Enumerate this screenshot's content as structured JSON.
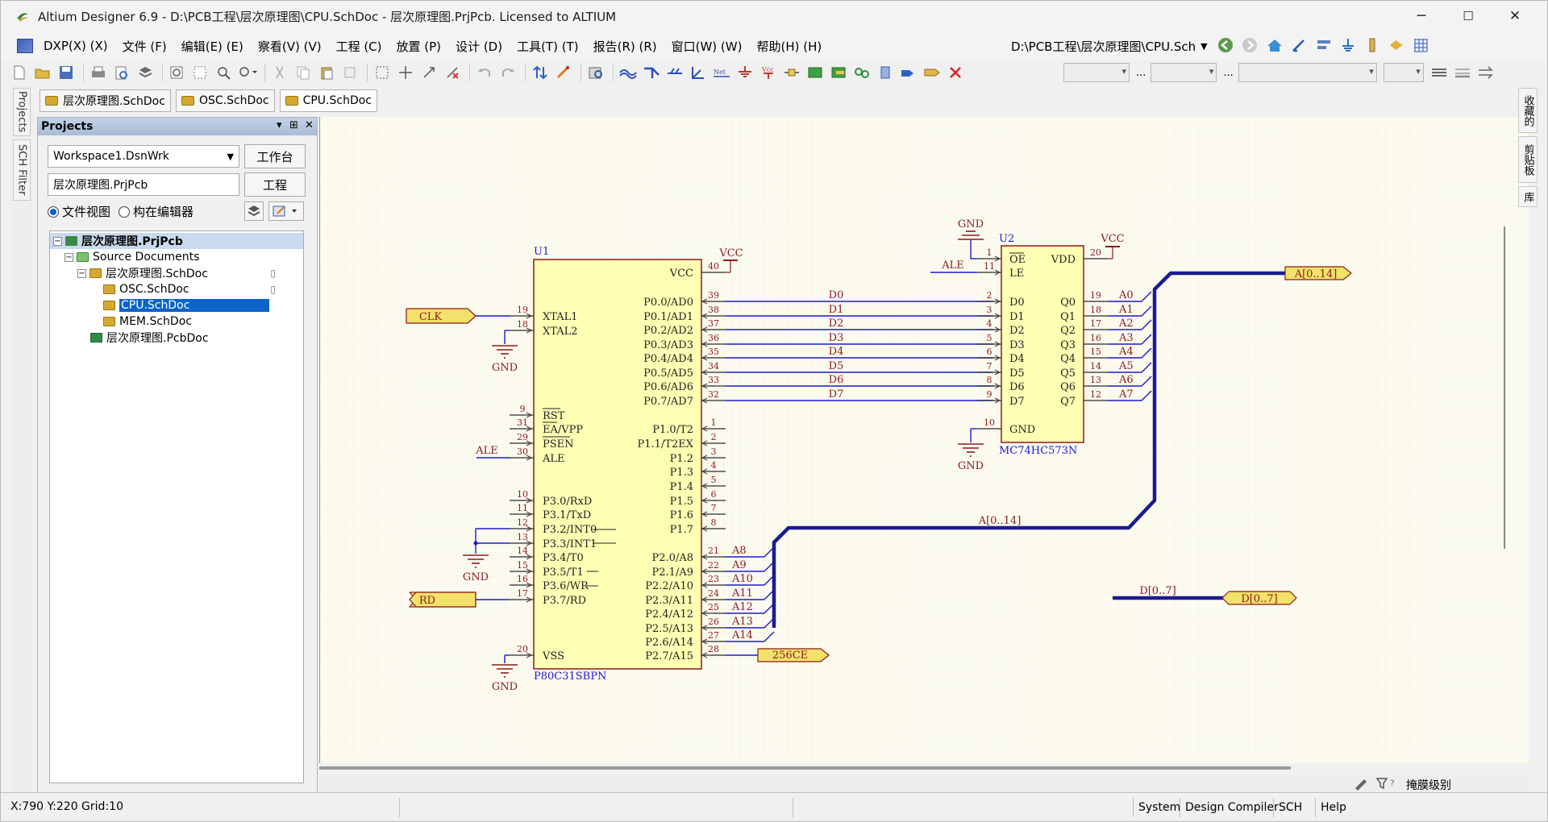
{
  "window": {
    "title": "Altium Designer 6.9 - D:\\PCB工程\\层次原理图\\CPU.SchDoc - 层次原理图.PrjPcb. Licensed to ALTIUM",
    "controls": {
      "minimize": "─",
      "maximize": "☐",
      "close": "✕"
    }
  },
  "menu": [
    "DXP(X) (X)",
    "文件 (F)",
    "编辑(E) (E)",
    "察看(V) (V)",
    "工程 (C)",
    "放置 (P)",
    "设计 (D)",
    "工具(T) (T)",
    "报告(R) (R)",
    "窗口(W) (W)",
    "帮助(H) (H)"
  ],
  "path_combo": "D:\\PCB工程\\层次原理图\\CPU.Sch",
  "left_vertical_tabs": [
    "Projects",
    "SCH Filter"
  ],
  "right_vertical_tabs": [
    "收藏的",
    "剪贴板",
    "库"
  ],
  "doc_tabs": [
    "层次原理图.SchDoc",
    "OSC.SchDoc",
    "CPU.SchDoc"
  ],
  "projects_panel": {
    "title": "Projects",
    "workspace": "Workspace1.DsnWrk",
    "workspace_button": "工作台",
    "project": "层次原理图.PrjPcb",
    "project_button": "工程",
    "view_file": "文件视图",
    "view_struct": "构在编辑器",
    "tree": [
      {
        "label": "层次原理图.PrjPcb",
        "level": 0,
        "bold": true
      },
      {
        "label": "Source Documents",
        "level": 1
      },
      {
        "label": "层次原理图.SchDoc",
        "level": 2
      },
      {
        "label": "OSC.SchDoc",
        "level": 3
      },
      {
        "label": "CPU.SchDoc",
        "level": 3,
        "selected": true
      },
      {
        "label": "MEM.SchDoc",
        "level": 3
      },
      {
        "label": "层次原理图.PcbDoc",
        "level": 2
      }
    ]
  },
  "schematic": {
    "u1": {
      "designator": "U1",
      "part": "P80C31SBPN",
      "left_pins": [
        {
          "num": "19",
          "name": "XTAL1"
        },
        {
          "num": "18",
          "name": "XTAL2"
        },
        {
          "num": "9",
          "name": "RST"
        },
        {
          "num": "31",
          "name": "EA/VPP"
        },
        {
          "num": "29",
          "name": "PSEN"
        },
        {
          "num": "30",
          "name": "ALE"
        },
        {
          "num": "10",
          "name": "P3.0/RxD"
        },
        {
          "num": "11",
          "name": "P3.1/TxD"
        },
        {
          "num": "12",
          "name": "P3.2/INT0"
        },
        {
          "num": "13",
          "name": "P3.3/INT1"
        },
        {
          "num": "14",
          "name": "P3.4/T0"
        },
        {
          "num": "15",
          "name": "P3.5/T1"
        },
        {
          "num": "16",
          "name": "P3.6/WR"
        },
        {
          "num": "17",
          "name": "P3.7/RD"
        },
        {
          "num": "20",
          "name": "VSS"
        }
      ],
      "right_pins": [
        {
          "num": "40",
          "name": "VCC"
        },
        {
          "num": "39",
          "name": "P0.0/AD0"
        },
        {
          "num": "38",
          "name": "P0.1/AD1"
        },
        {
          "num": "37",
          "name": "P0.2/AD2"
        },
        {
          "num": "36",
          "name": "P0.3/AD3"
        },
        {
          "num": "35",
          "name": "P0.4/AD4"
        },
        {
          "num": "34",
          "name": "P0.5/AD5"
        },
        {
          "num": "33",
          "name": "P0.6/AD6"
        },
        {
          "num": "32",
          "name": "P0.7/AD7"
        },
        {
          "num": "1",
          "name": "P1.0/T2"
        },
        {
          "num": "2",
          "name": "P1.1/T2EX"
        },
        {
          "num": "3",
          "name": "P1.2"
        },
        {
          "num": "4",
          "name": "P1.3"
        },
        {
          "num": "5",
          "name": "P1.4"
        },
        {
          "num": "6",
          "name": "P1.5"
        },
        {
          "num": "7",
          "name": "P1.6"
        },
        {
          "num": "8",
          "name": "P1.7"
        },
        {
          "num": "21",
          "name": "P2.0/A8"
        },
        {
          "num": "22",
          "name": "P2.1/A9"
        },
        {
          "num": "23",
          "name": "P2.2/A10"
        },
        {
          "num": "24",
          "name": "P2.3/A11"
        },
        {
          "num": "25",
          "name": "P2.4/A12"
        },
        {
          "num": "26",
          "name": "P2.5/A13"
        },
        {
          "num": "27",
          "name": "P2.6/A14"
        },
        {
          "num": "28",
          "name": "P2.7/A15"
        }
      ]
    },
    "u2": {
      "designator": "U2",
      "part": "MC74HC573N",
      "left_pins": [
        {
          "num": "1",
          "name": "OE"
        },
        {
          "num": "11",
          "name": "LE"
        },
        {
          "num": "2",
          "name": "D0"
        },
        {
          "num": "3",
          "name": "D1"
        },
        {
          "num": "4",
          "name": "D2"
        },
        {
          "num": "5",
          "name": "D3"
        },
        {
          "num": "6",
          "name": "D4"
        },
        {
          "num": "7",
          "name": "D5"
        },
        {
          "num": "8",
          "name": "D6"
        },
        {
          "num": "9",
          "name": "D7"
        },
        {
          "num": "10",
          "name": "GND"
        }
      ],
      "right_pins": [
        {
          "num": "20",
          "name": "VDD"
        },
        {
          "num": "19",
          "name": "Q0"
        },
        {
          "num": "18",
          "name": "Q1"
        },
        {
          "num": "17",
          "name": "Q2"
        },
        {
          "num": "16",
          "name": "Q3"
        },
        {
          "num": "15",
          "name": "Q4"
        },
        {
          "num": "14",
          "name": "Q5"
        },
        {
          "num": "13",
          "name": "Q6"
        },
        {
          "num": "12",
          "name": "Q7"
        }
      ]
    },
    "data_nets": [
      "D0",
      "D1",
      "D2",
      "D3",
      "D4",
      "D5",
      "D6",
      "D7"
    ],
    "addr_low_nets": [
      "A0",
      "A1",
      "A2",
      "A3",
      "A4",
      "A5",
      "A6",
      "A7"
    ],
    "addr_high_nets": [
      "A8",
      "A9",
      "A10",
      "A11",
      "A12",
      "A13",
      "A14"
    ],
    "ports": {
      "clk": "CLK",
      "rd": "RD",
      "ce": "256CE",
      "abus": "A[0..14]",
      "dbus": "D[0..7]"
    },
    "bus_labels": {
      "a": "A[0..14]",
      "d": "D[0..7]"
    },
    "power": {
      "vcc": "VCC",
      "gnd": "GND"
    },
    "net_ale": "ALE"
  },
  "status": {
    "coords": "X:790 Y:220  Grid:10",
    "buttons": [
      "System",
      "Design Compiler",
      "SCH",
      "Help"
    ],
    "mask_level": "掩膜级别"
  }
}
